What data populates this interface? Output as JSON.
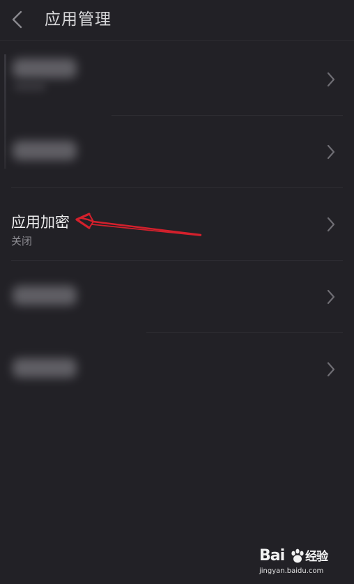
{
  "header": {
    "title": "应用管理",
    "back_icon": "chevron-left-icon"
  },
  "list": {
    "items": [
      {
        "title": "",
        "subtitle": "",
        "blurred": true
      },
      {
        "title": "",
        "subtitle": "",
        "blurred": true
      },
      {
        "title": "应用加密",
        "subtitle": "关闭",
        "blurred": false
      },
      {
        "title": "",
        "subtitle": "",
        "blurred": true
      },
      {
        "title": "",
        "subtitle": "",
        "blurred": true
      }
    ]
  },
  "annotation": {
    "arrow_color": "#d4202c"
  },
  "watermark": {
    "logo_left": "Bai",
    "logo_right": "经验",
    "url": "jingyan.baidu.com"
  },
  "colors": {
    "background": "#222126",
    "text_primary": "#ededee",
    "text_secondary": "#8e8d93",
    "chevron": "#6f6e74"
  }
}
